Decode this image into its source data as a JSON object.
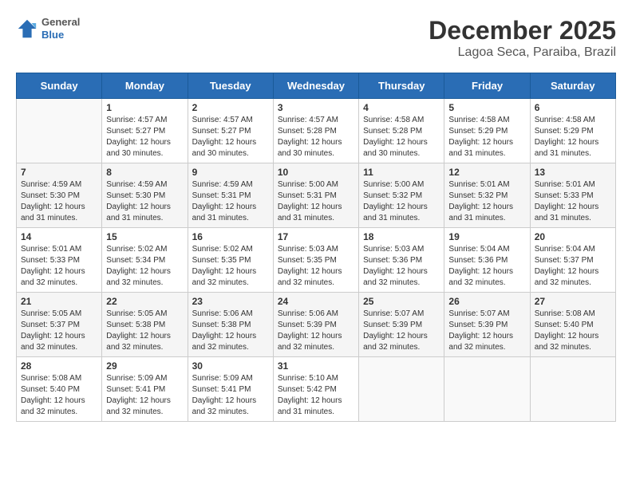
{
  "logo": {
    "general": "General",
    "blue": "Blue"
  },
  "header": {
    "title": "December 2025",
    "subtitle": "Lagoa Seca, Paraiba, Brazil"
  },
  "weekdays": [
    "Sunday",
    "Monday",
    "Tuesday",
    "Wednesday",
    "Thursday",
    "Friday",
    "Saturday"
  ],
  "weeks": [
    [
      {
        "day": "",
        "empty": true
      },
      {
        "day": "1",
        "sunrise": "Sunrise: 4:57 AM",
        "sunset": "Sunset: 5:27 PM",
        "daylight": "Daylight: 12 hours and 30 minutes."
      },
      {
        "day": "2",
        "sunrise": "Sunrise: 4:57 AM",
        "sunset": "Sunset: 5:27 PM",
        "daylight": "Daylight: 12 hours and 30 minutes."
      },
      {
        "day": "3",
        "sunrise": "Sunrise: 4:57 AM",
        "sunset": "Sunset: 5:28 PM",
        "daylight": "Daylight: 12 hours and 30 minutes."
      },
      {
        "day": "4",
        "sunrise": "Sunrise: 4:58 AM",
        "sunset": "Sunset: 5:28 PM",
        "daylight": "Daylight: 12 hours and 30 minutes."
      },
      {
        "day": "5",
        "sunrise": "Sunrise: 4:58 AM",
        "sunset": "Sunset: 5:29 PM",
        "daylight": "Daylight: 12 hours and 31 minutes."
      },
      {
        "day": "6",
        "sunrise": "Sunrise: 4:58 AM",
        "sunset": "Sunset: 5:29 PM",
        "daylight": "Daylight: 12 hours and 31 minutes."
      }
    ],
    [
      {
        "day": "7",
        "sunrise": "Sunrise: 4:59 AM",
        "sunset": "Sunset: 5:30 PM",
        "daylight": "Daylight: 12 hours and 31 minutes."
      },
      {
        "day": "8",
        "sunrise": "Sunrise: 4:59 AM",
        "sunset": "Sunset: 5:30 PM",
        "daylight": "Daylight: 12 hours and 31 minutes."
      },
      {
        "day": "9",
        "sunrise": "Sunrise: 4:59 AM",
        "sunset": "Sunset: 5:31 PM",
        "daylight": "Daylight: 12 hours and 31 minutes."
      },
      {
        "day": "10",
        "sunrise": "Sunrise: 5:00 AM",
        "sunset": "Sunset: 5:31 PM",
        "daylight": "Daylight: 12 hours and 31 minutes."
      },
      {
        "day": "11",
        "sunrise": "Sunrise: 5:00 AM",
        "sunset": "Sunset: 5:32 PM",
        "daylight": "Daylight: 12 hours and 31 minutes."
      },
      {
        "day": "12",
        "sunrise": "Sunrise: 5:01 AM",
        "sunset": "Sunset: 5:32 PM",
        "daylight": "Daylight: 12 hours and 31 minutes."
      },
      {
        "day": "13",
        "sunrise": "Sunrise: 5:01 AM",
        "sunset": "Sunset: 5:33 PM",
        "daylight": "Daylight: 12 hours and 31 minutes."
      }
    ],
    [
      {
        "day": "14",
        "sunrise": "Sunrise: 5:01 AM",
        "sunset": "Sunset: 5:33 PM",
        "daylight": "Daylight: 12 hours and 32 minutes."
      },
      {
        "day": "15",
        "sunrise": "Sunrise: 5:02 AM",
        "sunset": "Sunset: 5:34 PM",
        "daylight": "Daylight: 12 hours and 32 minutes."
      },
      {
        "day": "16",
        "sunrise": "Sunrise: 5:02 AM",
        "sunset": "Sunset: 5:35 PM",
        "daylight": "Daylight: 12 hours and 32 minutes."
      },
      {
        "day": "17",
        "sunrise": "Sunrise: 5:03 AM",
        "sunset": "Sunset: 5:35 PM",
        "daylight": "Daylight: 12 hours and 32 minutes."
      },
      {
        "day": "18",
        "sunrise": "Sunrise: 5:03 AM",
        "sunset": "Sunset: 5:36 PM",
        "daylight": "Daylight: 12 hours and 32 minutes."
      },
      {
        "day": "19",
        "sunrise": "Sunrise: 5:04 AM",
        "sunset": "Sunset: 5:36 PM",
        "daylight": "Daylight: 12 hours and 32 minutes."
      },
      {
        "day": "20",
        "sunrise": "Sunrise: 5:04 AM",
        "sunset": "Sunset: 5:37 PM",
        "daylight": "Daylight: 12 hours and 32 minutes."
      }
    ],
    [
      {
        "day": "21",
        "sunrise": "Sunrise: 5:05 AM",
        "sunset": "Sunset: 5:37 PM",
        "daylight": "Daylight: 12 hours and 32 minutes."
      },
      {
        "day": "22",
        "sunrise": "Sunrise: 5:05 AM",
        "sunset": "Sunset: 5:38 PM",
        "daylight": "Daylight: 12 hours and 32 minutes."
      },
      {
        "day": "23",
        "sunrise": "Sunrise: 5:06 AM",
        "sunset": "Sunset: 5:38 PM",
        "daylight": "Daylight: 12 hours and 32 minutes."
      },
      {
        "day": "24",
        "sunrise": "Sunrise: 5:06 AM",
        "sunset": "Sunset: 5:39 PM",
        "daylight": "Daylight: 12 hours and 32 minutes."
      },
      {
        "day": "25",
        "sunrise": "Sunrise: 5:07 AM",
        "sunset": "Sunset: 5:39 PM",
        "daylight": "Daylight: 12 hours and 32 minutes."
      },
      {
        "day": "26",
        "sunrise": "Sunrise: 5:07 AM",
        "sunset": "Sunset: 5:39 PM",
        "daylight": "Daylight: 12 hours and 32 minutes."
      },
      {
        "day": "27",
        "sunrise": "Sunrise: 5:08 AM",
        "sunset": "Sunset: 5:40 PM",
        "daylight": "Daylight: 12 hours and 32 minutes."
      }
    ],
    [
      {
        "day": "28",
        "sunrise": "Sunrise: 5:08 AM",
        "sunset": "Sunset: 5:40 PM",
        "daylight": "Daylight: 12 hours and 32 minutes."
      },
      {
        "day": "29",
        "sunrise": "Sunrise: 5:09 AM",
        "sunset": "Sunset: 5:41 PM",
        "daylight": "Daylight: 12 hours and 32 minutes."
      },
      {
        "day": "30",
        "sunrise": "Sunrise: 5:09 AM",
        "sunset": "Sunset: 5:41 PM",
        "daylight": "Daylight: 12 hours and 32 minutes."
      },
      {
        "day": "31",
        "sunrise": "Sunrise: 5:10 AM",
        "sunset": "Sunset: 5:42 PM",
        "daylight": "Daylight: 12 hours and 31 minutes."
      },
      {
        "day": "",
        "empty": true
      },
      {
        "day": "",
        "empty": true
      },
      {
        "day": "",
        "empty": true
      }
    ]
  ]
}
